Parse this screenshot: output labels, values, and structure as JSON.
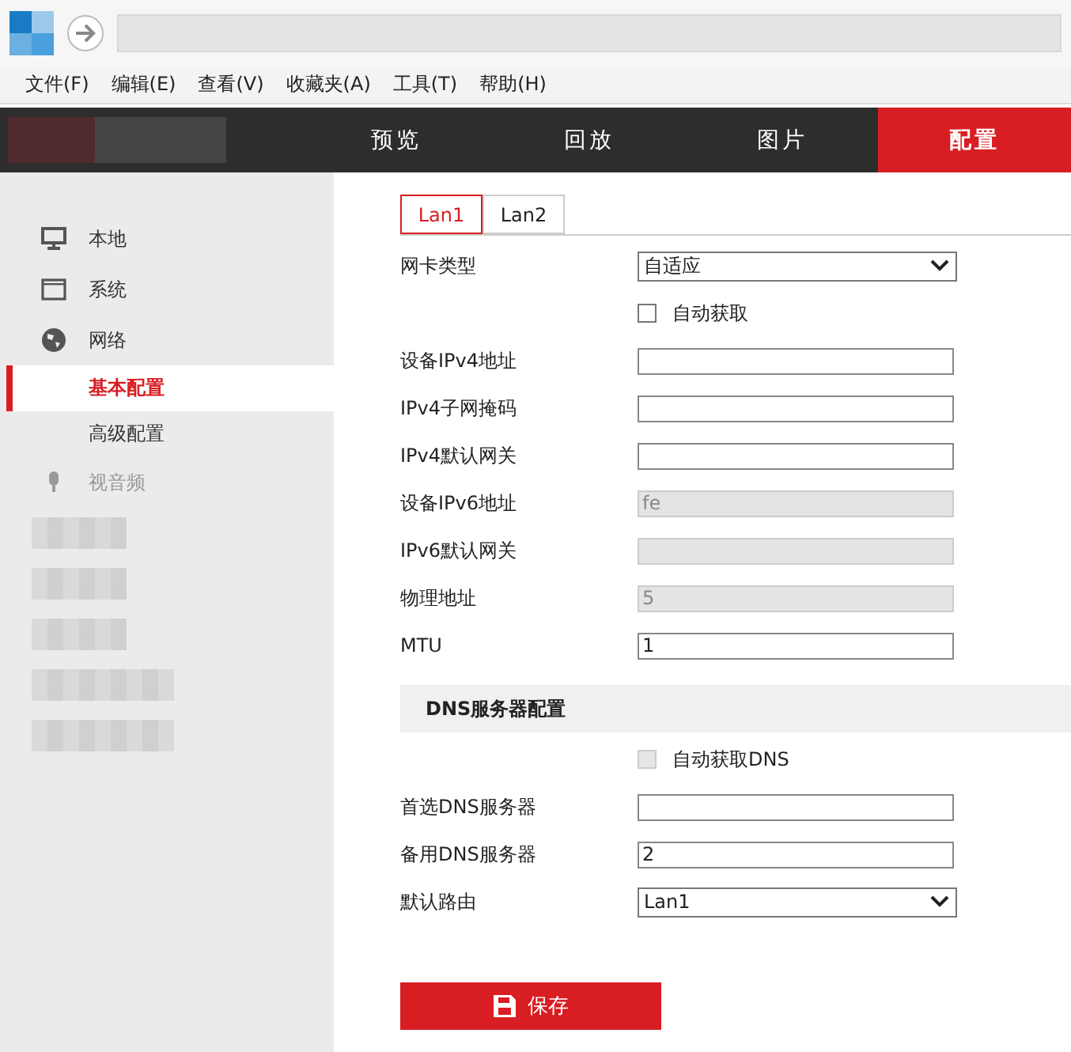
{
  "menu_bar": [
    "文件(F)",
    "编辑(E)",
    "查看(V)",
    "收藏夹(A)",
    "工具(T)",
    "帮助(H)"
  ],
  "nav_tabs": [
    {
      "label": "预览",
      "selected": false
    },
    {
      "label": "回放",
      "selected": false
    },
    {
      "label": "图片",
      "selected": false
    },
    {
      "label": "配置",
      "selected": true
    }
  ],
  "sidebar": {
    "items": [
      {
        "label": "本地",
        "selected": false,
        "disabled": false
      },
      {
        "label": "系统",
        "selected": false,
        "disabled": false
      },
      {
        "label": "网络",
        "selected": false,
        "disabled": false,
        "children": [
          {
            "label": "基本配置",
            "selected": true
          },
          {
            "label": "高级配置",
            "selected": false
          }
        ]
      },
      {
        "label": "视音频",
        "selected": false,
        "disabled": true
      }
    ]
  },
  "lan_tabs": [
    {
      "label": "Lan1",
      "selected": true
    },
    {
      "label": "Lan2",
      "selected": false
    }
  ],
  "form": [
    {
      "kind": "select",
      "label": "网卡类型",
      "value": "自适应"
    },
    {
      "kind": "checkbox",
      "label": "自动获取",
      "checked": false,
      "disabled": false
    },
    {
      "kind": "input",
      "label": "设备IPv4地址",
      "disabled": false
    },
    {
      "kind": "input",
      "label": "IPv4子网掩码",
      "disabled": false
    },
    {
      "kind": "input",
      "label": "IPv4默认网关",
      "disabled": false
    },
    {
      "kind": "input",
      "label": "设备IPv6地址",
      "value": "fe",
      "disabled": true
    },
    {
      "kind": "input",
      "label": "IPv6默认网关",
      "disabled": true
    },
    {
      "kind": "input",
      "label": "物理地址",
      "value": "5",
      "disabled": true
    },
    {
      "kind": "input",
      "label": "MTU",
      "value": "1",
      "disabled": false
    },
    {
      "kind": "section",
      "label": "DNS服务器配置"
    },
    {
      "kind": "checkbox",
      "label": "自动获取DNS",
      "checked": false,
      "disabled": true
    },
    {
      "kind": "input",
      "label": "首选DNS服务器",
      "disabled": false
    },
    {
      "kind": "input",
      "label": "备用DNS服务器",
      "value": "2",
      "disabled": false
    },
    {
      "kind": "select",
      "label": "默认路由",
      "value": "Lan1"
    }
  ],
  "save_button": "保存"
}
